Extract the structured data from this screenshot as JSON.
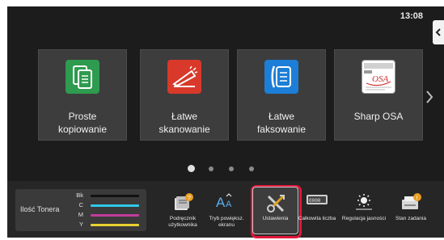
{
  "header": {
    "clock": "13:08"
  },
  "tiles": [
    {
      "label_line1": "Proste",
      "label_line2": "kopiowanie",
      "icon": "copy-icon",
      "color": "#2e9b4f"
    },
    {
      "label_line1": "Łatwe",
      "label_line2": "skanowanie",
      "icon": "scan-icon",
      "color": "#d8392b"
    },
    {
      "label_line1": "Łatwe",
      "label_line2": "faksowanie",
      "icon": "fax-icon",
      "color": "#1c7ed6"
    },
    {
      "label_line1": "Sharp OSA",
      "label_line2": "",
      "icon": "sharp-osa-icon",
      "color": "#ffffff"
    }
  ],
  "pager": {
    "pages": 4,
    "active": 1
  },
  "toner": {
    "title": "Ilość Tonera",
    "rows": [
      {
        "label": "Bk",
        "color": "#111111"
      },
      {
        "label": "C",
        "color": "#30c8e8"
      },
      {
        "label": "M",
        "color": "#c03c9c"
      },
      {
        "label": "Y",
        "color": "#e8d030"
      }
    ]
  },
  "bottom_buttons": [
    {
      "label": "Podręcznik użytkownika",
      "icon": "manual-icon"
    },
    {
      "label": "Tryb powiększ. ekranu",
      "icon": "zoom-text-icon"
    },
    {
      "label": "Ustawienia",
      "icon": "settings-icon",
      "highlighted": true
    },
    {
      "label": "Całkowita liczba",
      "icon": "counter-icon"
    },
    {
      "label": "Regulacja jasności",
      "icon": "brightness-icon"
    },
    {
      "label": "Stan zadania",
      "icon": "job-status-icon"
    }
  ],
  "colors": {
    "highlight": "#e1173a",
    "background": "#1c1c1c",
    "tile": "#3d3d3d"
  }
}
